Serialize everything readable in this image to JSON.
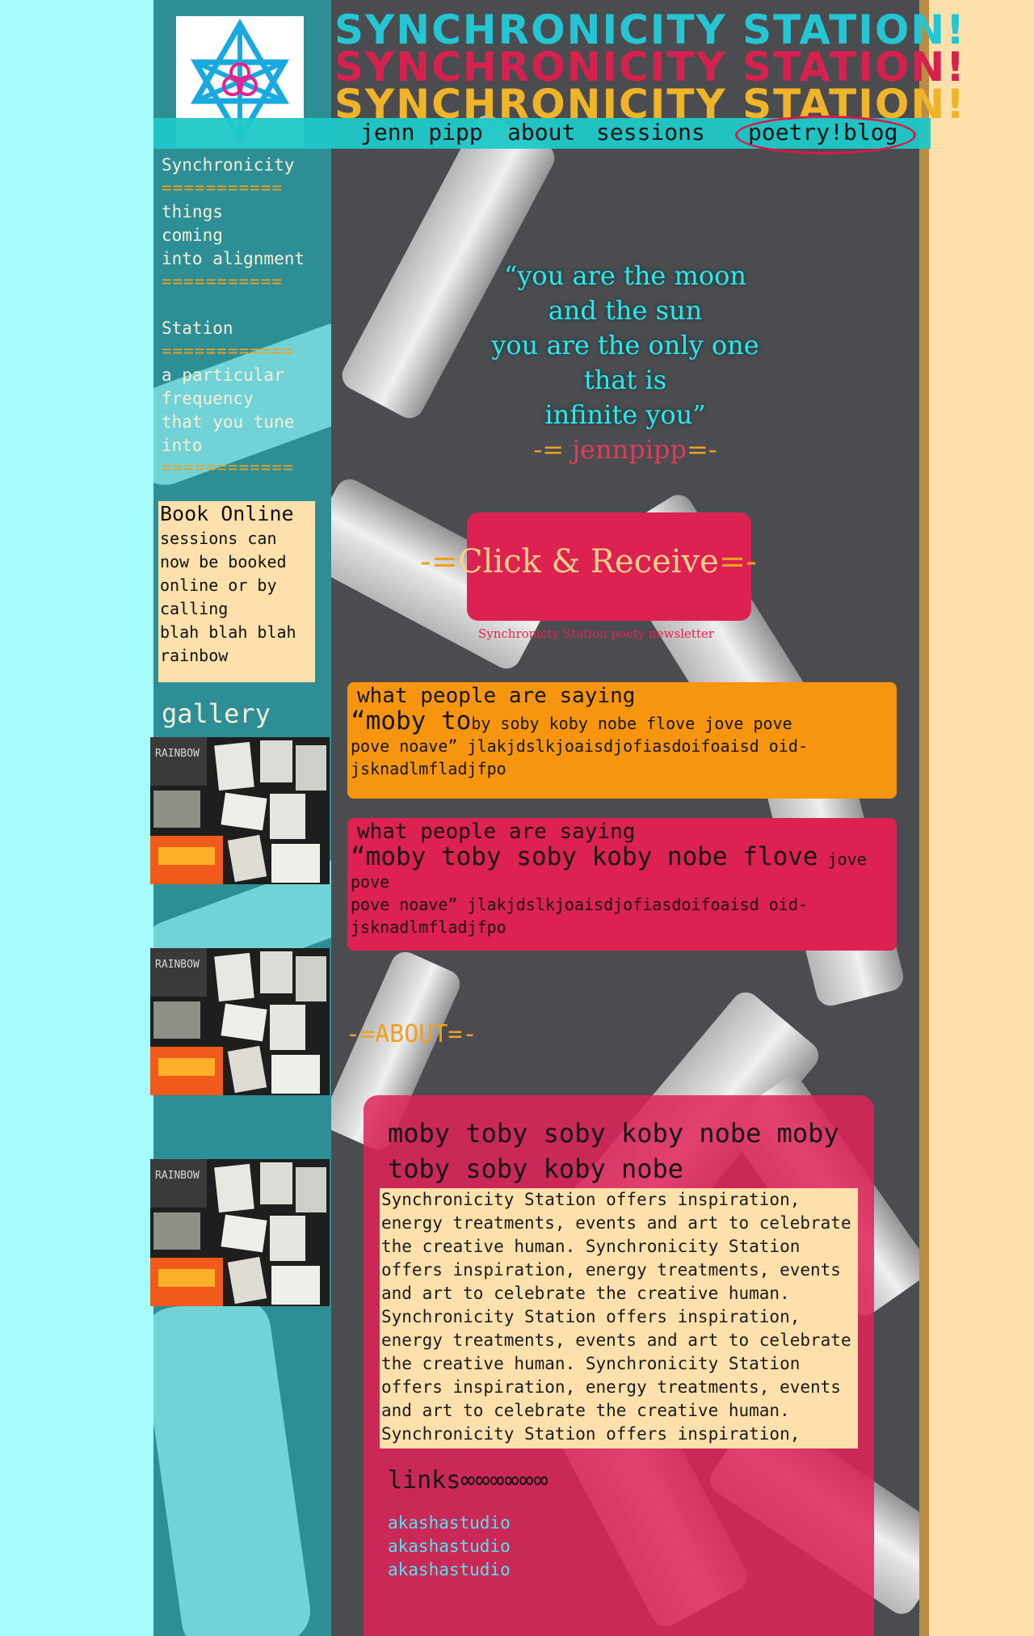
{
  "site": {
    "title_lines": [
      "SYNCHRONICITY STATION!",
      "SYNCHRONICITY STATION!",
      "SYNCHRONICITY STATION!"
    ],
    "title_colors": [
      "#24c6d4",
      "#d6214f",
      "#f0b429"
    ]
  },
  "nav": {
    "items": [
      "jenn pipp",
      "about",
      "sessions",
      "poetry!blog"
    ]
  },
  "sidebar": {
    "term1": "Synchronicity",
    "equals1": "===========",
    "def1": [
      "things",
      "coming",
      "into alignment"
    ],
    "equals2": "===========",
    "term2": "Station",
    "equals3": "============",
    "def2": [
      "a particular",
      "frequency",
      "that you tune",
      "into"
    ],
    "equals4": "============"
  },
  "booking": {
    "title": "Book Online",
    "lines": [
      "sessions can",
      "now be booked",
      "online or by",
      "calling",
      "blah blah blah",
      "rainbow"
    ]
  },
  "gallery": {
    "title": "gallery",
    "thumb_text": "RAINBOW"
  },
  "quote": {
    "lines": [
      "“you are the moon",
      "and the sun",
      "you are the only one",
      "that is",
      "infinite you”"
    ],
    "sig_prefix": "-=",
    "sig_name": " jennpipp",
    "sig_suffix": "=-"
  },
  "cta": {
    "dash_left": "-=",
    "label": "Click & Receive",
    "dash_right": "=-",
    "sub": "Synchronicty Station poety newsletter"
  },
  "testimonials": [
    {
      "heading": "what people are saying",
      "big": "“moby to",
      "rest": "by soby koby nobe flove jove pove",
      "line2": "pove noave” jlakjdslkjoaisdjofiasdoifoaisd oid-",
      "line3": "jsknadlmfladjfpo",
      "color": "#f7960e"
    },
    {
      "heading": "what people are saying",
      "big": "“moby toby soby koby nobe flove",
      "rest": " jove",
      "line2a": "pove",
      "line2": "pove noave” jlakjdslkjoaisdjofiasdoifoaisd oid-",
      "line3": "jsknadlmfladjfpo",
      "color": "#dd2150"
    }
  ],
  "about": {
    "heading": "-=ABOUT=-",
    "title": "moby toby soby koby nobe moby toby soby koby nobe",
    "body": "Synchronicity Station offers inspiration, energy treatments, events and art to celebrate the creative human. Synchronicity Station offers inspiration, energy treatments, events and art to celebrate the creative human. Synchronicity Station offers inspiration, energy treatments, events and art to celebrate the creative human. Synchronicity Station offers inspiration, energy treatments, events and art to celebrate the creative human. Synchronicity Station offers inspiration,",
    "links_title": "links∞∞∞∞∞∞",
    "links": [
      "akashastudio",
      "akashastudio",
      "akashastudio"
    ]
  }
}
